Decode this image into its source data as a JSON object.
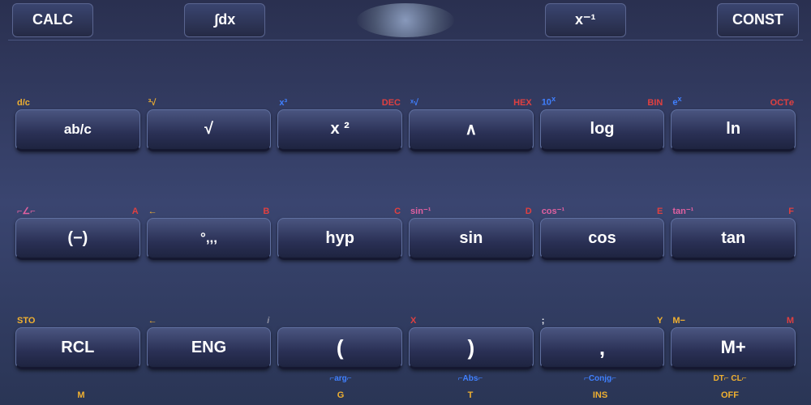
{
  "calculator": {
    "topRow": {
      "calcLabel": "CALC",
      "integralLabel": "∫dx",
      "xInvLabel": "x⁻¹",
      "constLabel": "CONST"
    },
    "row1": {
      "labels": [
        {
          "left": "d/c",
          "right": "",
          "leftColor": "yellow"
        },
        {
          "left": "³√",
          "right": "",
          "leftColor": "yellow"
        },
        {
          "left": "x³",
          "right": "DEC",
          "leftColor": "blue",
          "rightColor": "red"
        },
        {
          "left": "ˣ√",
          "right": "HEX",
          "leftColor": "blue",
          "rightColor": "red"
        },
        {
          "left": "10ˣ",
          "right": "BIN",
          "leftColor": "blue",
          "rightColor": "red"
        },
        {
          "left": "eˣ",
          "right": "OCTe",
          "leftColor": "blue",
          "rightColor": "red"
        }
      ],
      "buttons": [
        "ab/c",
        "√",
        "x²",
        "∧",
        "log",
        "ln"
      ]
    },
    "row2": {
      "labels": [
        {
          "left": "⌐∠⌐",
          "right": "A",
          "leftColor": "pink",
          "rightColor": "red"
        },
        {
          "left": "←",
          "right": "B",
          "leftColor": "yellow",
          "rightColor": "red"
        },
        {
          "left": "",
          "right": "C",
          "leftColor": "",
          "rightColor": "red"
        },
        {
          "left": "sin⁻¹",
          "right": "D",
          "leftColor": "pink",
          "rightColor": "red"
        },
        {
          "left": "cos⁻¹",
          "right": "E",
          "leftColor": "pink",
          "rightColor": "red"
        },
        {
          "left": "tan⁻¹",
          "right": "F",
          "leftColor": "pink",
          "rightColor": "red"
        }
      ],
      "buttons": [
        "(−)",
        "◦,,,",
        "hyp",
        "sin",
        "cos",
        "tan"
      ]
    },
    "row3": {
      "labels": [
        {
          "left": "STO",
          "right": "",
          "leftColor": "yellow"
        },
        {
          "left": "←",
          "right": "i",
          "leftColor": "yellow",
          "rightColor": "gray"
        },
        {
          "left": "",
          "right": "",
          "leftColor": ""
        },
        {
          "left": "",
          "right": "X",
          "leftColor": "",
          "rightColor": "red"
        },
        {
          "left": ";",
          "right": "Y",
          "leftColor": "white",
          "rightColor": "yellow"
        },
        {
          "left": "M−",
          "right": "M",
          "leftColor": "yellow",
          "rightColor": "red"
        }
      ],
      "buttons": [
        "RCL",
        "ENG",
        "(",
        ")",
        ",",
        "M+"
      ]
    },
    "row3SubLabels": {
      "cells": [
        "",
        "",
        "⌐arg⌐",
        "⌐Abs⌐",
        "⌐Conjg⌐",
        "DT⌐ CL⌐"
      ],
      "colors": [
        "",
        "",
        "blue",
        "blue",
        "blue",
        "yellow"
      ]
    },
    "bottomRow": {
      "cells": [
        "M",
        "",
        "G",
        "",
        "T",
        "INS",
        "",
        "OFF"
      ],
      "colors": [
        "yellow",
        "",
        "yellow",
        "",
        "yellow",
        "yellow",
        "",
        "yellow"
      ]
    }
  }
}
